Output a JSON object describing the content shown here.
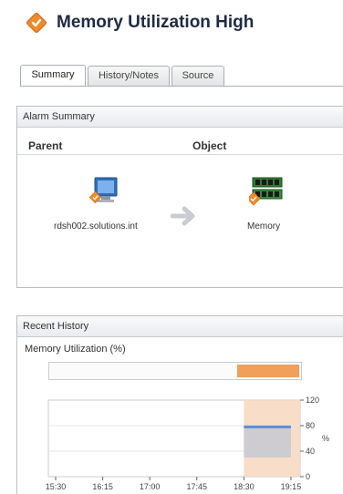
{
  "header": {
    "title": "Memory Utilization High"
  },
  "tabs": [
    {
      "label": "Summary"
    },
    {
      "label": "History/Notes"
    },
    {
      "label": "Source"
    }
  ],
  "alarm_summary": {
    "title": "Alarm Summary",
    "parent_header": "Parent",
    "object_header": "Object",
    "parent_name": "rdsh002.solutions.int",
    "object_name": "Memory"
  },
  "recent_history": {
    "title": "Recent History",
    "chart_title": "Memory Utilization (%)",
    "y_ticks": [
      "120",
      "80",
      "40",
      "0"
    ],
    "y_unit": "%",
    "x_ticks": [
      "15:30",
      "16:15",
      "17:00",
      "17:45",
      "18:30",
      "19:15"
    ]
  },
  "colors": {
    "accent_orange": "#f0a05a",
    "alert_shade": "#f7d8bf",
    "series_blue": "#5b8fd6",
    "title_navy": "#1f2a44"
  },
  "chart_data": {
    "type": "line",
    "title": "Memory Utilization (%)",
    "ylabel": "%",
    "ylim": [
      0,
      120
    ],
    "x_labels": [
      "15:30",
      "16:15",
      "17:00",
      "17:45",
      "18:30",
      "19:15"
    ],
    "series": [
      {
        "x": [
          "18:30",
          "19:15"
        ],
        "values": [
          78,
          78
        ]
      }
    ],
    "highlight_range": [
      "18:30",
      "19:45"
    ]
  }
}
